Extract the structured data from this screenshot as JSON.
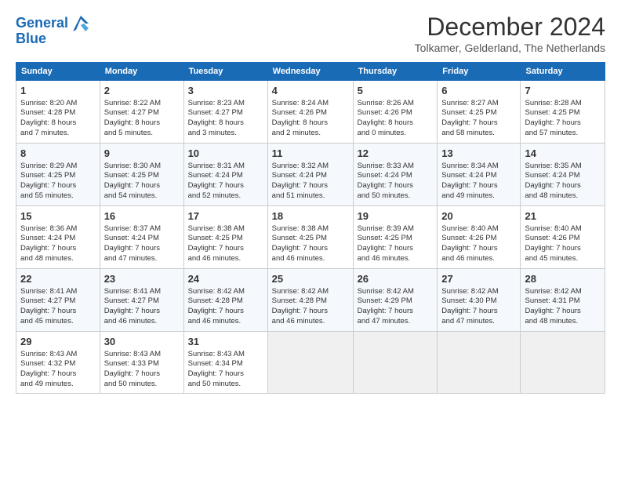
{
  "logo": {
    "line1": "General",
    "line2": "Blue"
  },
  "title": "December 2024",
  "subtitle": "Tolkamer, Gelderland, The Netherlands",
  "weekdays": [
    "Sunday",
    "Monday",
    "Tuesday",
    "Wednesday",
    "Thursday",
    "Friday",
    "Saturday"
  ],
  "weeks": [
    [
      {
        "day": "1",
        "info": "Sunrise: 8:20 AM\nSunset: 4:28 PM\nDaylight: 8 hours\nand 7 minutes."
      },
      {
        "day": "2",
        "info": "Sunrise: 8:22 AM\nSunset: 4:27 PM\nDaylight: 8 hours\nand 5 minutes."
      },
      {
        "day": "3",
        "info": "Sunrise: 8:23 AM\nSunset: 4:27 PM\nDaylight: 8 hours\nand 3 minutes."
      },
      {
        "day": "4",
        "info": "Sunrise: 8:24 AM\nSunset: 4:26 PM\nDaylight: 8 hours\nand 2 minutes."
      },
      {
        "day": "5",
        "info": "Sunrise: 8:26 AM\nSunset: 4:26 PM\nDaylight: 8 hours\nand 0 minutes."
      },
      {
        "day": "6",
        "info": "Sunrise: 8:27 AM\nSunset: 4:25 PM\nDaylight: 7 hours\nand 58 minutes."
      },
      {
        "day": "7",
        "info": "Sunrise: 8:28 AM\nSunset: 4:25 PM\nDaylight: 7 hours\nand 57 minutes."
      }
    ],
    [
      {
        "day": "8",
        "info": "Sunrise: 8:29 AM\nSunset: 4:25 PM\nDaylight: 7 hours\nand 55 minutes."
      },
      {
        "day": "9",
        "info": "Sunrise: 8:30 AM\nSunset: 4:25 PM\nDaylight: 7 hours\nand 54 minutes."
      },
      {
        "day": "10",
        "info": "Sunrise: 8:31 AM\nSunset: 4:24 PM\nDaylight: 7 hours\nand 52 minutes."
      },
      {
        "day": "11",
        "info": "Sunrise: 8:32 AM\nSunset: 4:24 PM\nDaylight: 7 hours\nand 51 minutes."
      },
      {
        "day": "12",
        "info": "Sunrise: 8:33 AM\nSunset: 4:24 PM\nDaylight: 7 hours\nand 50 minutes."
      },
      {
        "day": "13",
        "info": "Sunrise: 8:34 AM\nSunset: 4:24 PM\nDaylight: 7 hours\nand 49 minutes."
      },
      {
        "day": "14",
        "info": "Sunrise: 8:35 AM\nSunset: 4:24 PM\nDaylight: 7 hours\nand 48 minutes."
      }
    ],
    [
      {
        "day": "15",
        "info": "Sunrise: 8:36 AM\nSunset: 4:24 PM\nDaylight: 7 hours\nand 48 minutes."
      },
      {
        "day": "16",
        "info": "Sunrise: 8:37 AM\nSunset: 4:24 PM\nDaylight: 7 hours\nand 47 minutes."
      },
      {
        "day": "17",
        "info": "Sunrise: 8:38 AM\nSunset: 4:25 PM\nDaylight: 7 hours\nand 46 minutes."
      },
      {
        "day": "18",
        "info": "Sunrise: 8:38 AM\nSunset: 4:25 PM\nDaylight: 7 hours\nand 46 minutes."
      },
      {
        "day": "19",
        "info": "Sunrise: 8:39 AM\nSunset: 4:25 PM\nDaylight: 7 hours\nand 46 minutes."
      },
      {
        "day": "20",
        "info": "Sunrise: 8:40 AM\nSunset: 4:26 PM\nDaylight: 7 hours\nand 46 minutes."
      },
      {
        "day": "21",
        "info": "Sunrise: 8:40 AM\nSunset: 4:26 PM\nDaylight: 7 hours\nand 45 minutes."
      }
    ],
    [
      {
        "day": "22",
        "info": "Sunrise: 8:41 AM\nSunset: 4:27 PM\nDaylight: 7 hours\nand 45 minutes."
      },
      {
        "day": "23",
        "info": "Sunrise: 8:41 AM\nSunset: 4:27 PM\nDaylight: 7 hours\nand 46 minutes."
      },
      {
        "day": "24",
        "info": "Sunrise: 8:42 AM\nSunset: 4:28 PM\nDaylight: 7 hours\nand 46 minutes."
      },
      {
        "day": "25",
        "info": "Sunrise: 8:42 AM\nSunset: 4:28 PM\nDaylight: 7 hours\nand 46 minutes."
      },
      {
        "day": "26",
        "info": "Sunrise: 8:42 AM\nSunset: 4:29 PM\nDaylight: 7 hours\nand 47 minutes."
      },
      {
        "day": "27",
        "info": "Sunrise: 8:42 AM\nSunset: 4:30 PM\nDaylight: 7 hours\nand 47 minutes."
      },
      {
        "day": "28",
        "info": "Sunrise: 8:42 AM\nSunset: 4:31 PM\nDaylight: 7 hours\nand 48 minutes."
      }
    ],
    [
      {
        "day": "29",
        "info": "Sunrise: 8:43 AM\nSunset: 4:32 PM\nDaylight: 7 hours\nand 49 minutes."
      },
      {
        "day": "30",
        "info": "Sunrise: 8:43 AM\nSunset: 4:33 PM\nDaylight: 7 hours\nand 50 minutes."
      },
      {
        "day": "31",
        "info": "Sunrise: 8:43 AM\nSunset: 4:34 PM\nDaylight: 7 hours\nand 50 minutes."
      },
      null,
      null,
      null,
      null
    ]
  ]
}
